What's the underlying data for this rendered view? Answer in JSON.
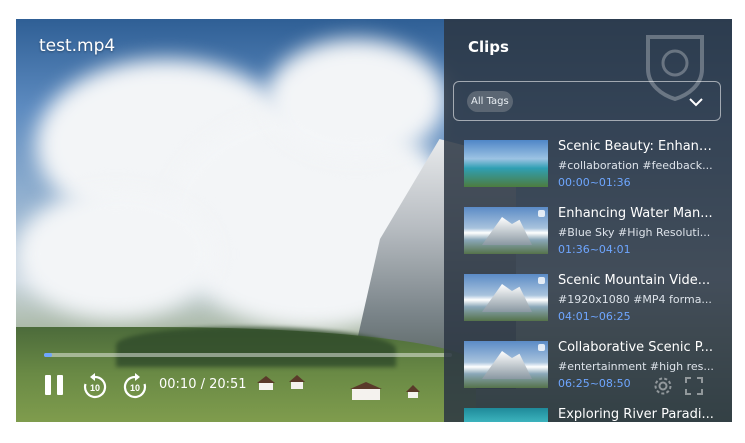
{
  "video": {
    "title": "test.mp4",
    "current_time": "00:10",
    "duration": "20:51",
    "time_display": "00:10 / 20:51",
    "progress_fraction": 0.008
  },
  "controls": {
    "rewind_seconds": "10",
    "forward_seconds": "10"
  },
  "clips_panel": {
    "title": "Clips",
    "tag_filter": {
      "selected": "All Tags"
    },
    "items": [
      {
        "title": "Scenic Beauty: Enhanc...",
        "tags": "#collaboration #feedback...",
        "range": "00:00~01:36",
        "thumb": "lake"
      },
      {
        "title": "Enhancing Water Man...",
        "tags": "#Blue Sky #High Resoluti...",
        "range": "01:36~04:01",
        "thumb": "mountain"
      },
      {
        "title": "Scenic Mountain Vide...",
        "tags": "#1920x1080 #MP4 forma...",
        "range": "04:01~06:25",
        "thumb": "mountain"
      },
      {
        "title": "Collaborative Scenic P...",
        "tags": "#entertainment #high res...",
        "range": "06:25~08:50",
        "thumb": "mountain"
      },
      {
        "title": "Exploring River Paradi...",
        "tags": "",
        "range": "",
        "thumb": "river"
      }
    ]
  },
  "colors": {
    "accent": "#6ea6ff",
    "panel_bg": "#2c3744"
  }
}
